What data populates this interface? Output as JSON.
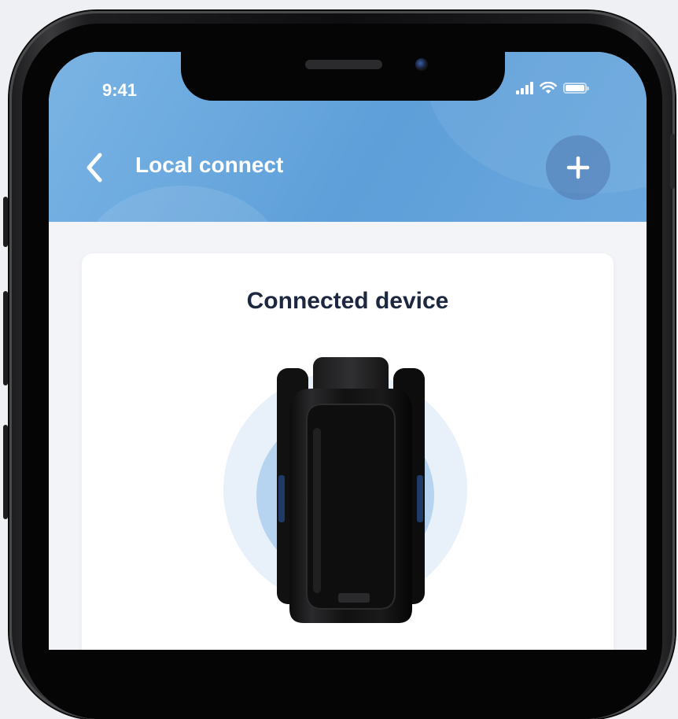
{
  "status_bar": {
    "time": "9:41",
    "icons": [
      "signal-icon",
      "wifi-icon",
      "battery-icon"
    ]
  },
  "header": {
    "title": "Local connect",
    "back_icon": "chevron-left-icon",
    "add_icon": "plus-icon",
    "gradient_colors": [
      "#7ab4e4",
      "#5e9fd9"
    ]
  },
  "card": {
    "title": "Connected device",
    "device_image": "smart-lock-device",
    "halo_colors": [
      "#e8f1fa",
      "#b6d3ef"
    ]
  }
}
